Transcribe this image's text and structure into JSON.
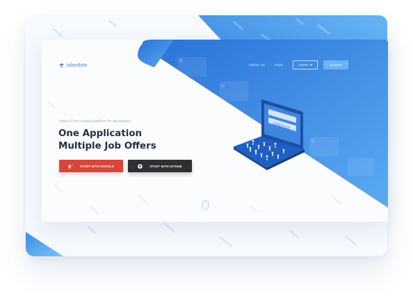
{
  "brand": {
    "name": "talentbite",
    "icon": "talentbite-logo-icon",
    "color": "#3d8ee8"
  },
  "nav": {
    "links": [
      "ABOUT US",
      "FAQS"
    ],
    "login_label": "LOGIN",
    "signup_label": "SIGNUP"
  },
  "hero": {
    "tagline": "India's First curated platform for developers",
    "headline_line1": "One Application",
    "headline_line2": "Multiple Job Offers",
    "google_button": {
      "label": "START WITH GOOGLE",
      "icon": "google-plus-icon",
      "color": "#d8463a"
    },
    "github_button": {
      "label": "START WITH GITHUB",
      "icon": "github-icon",
      "color": "#2f2f2f"
    }
  },
  "illustration": {
    "monitor_label": "CONTACT",
    "icon": "crowd-laptop-illustration"
  },
  "scroll_hint": {
    "icon": "scroll-mouse-icon"
  },
  "colors": {
    "accent_blue": "#3a8ae6",
    "light_blue": "#6fb3f5",
    "headline": "#243241"
  }
}
